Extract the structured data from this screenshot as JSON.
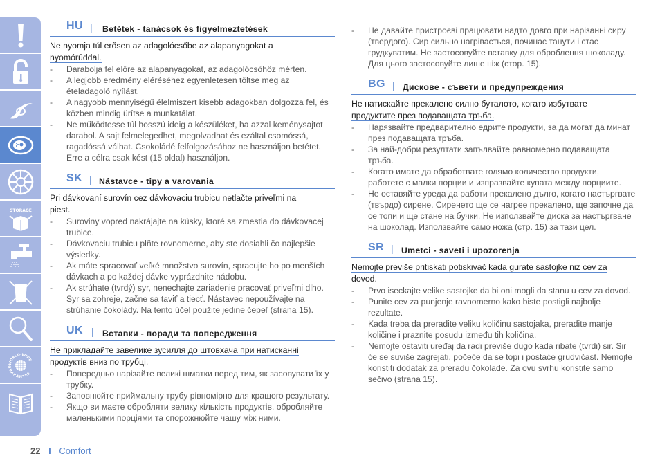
{
  "sidebar": {
    "tabs": [
      {
        "icon": "exclamation-icon",
        "active": false
      },
      {
        "icon": "unlocked-padlock-icon",
        "active": false
      },
      {
        "icon": "blade-icon",
        "active": false
      },
      {
        "icon": "disc-insert-icon",
        "active": true
      },
      {
        "icon": "fan-disc-icon",
        "active": false
      },
      {
        "icon": "storage-box-icon",
        "active": false
      },
      {
        "icon": "water-tap-icon",
        "active": false
      },
      {
        "icon": "crossed-bin-icon",
        "active": false
      },
      {
        "icon": "magnifier-icon",
        "active": false
      },
      {
        "icon": "world-wide-guarantee-icon",
        "active": false
      },
      {
        "icon": "open-book-icon",
        "active": false
      }
    ],
    "storage_text": "STORAGE",
    "guarantee_top": "WORLD-WIDE",
    "guarantee_bottom": "GUARANTEE"
  },
  "sections": {
    "hu": {
      "code": "HU",
      "separator": "|",
      "title": "Betétek - tanácsok és figyelmeztetések",
      "warning": [
        "Ne nyomja túl erősen az adagolócsőbe az alapanyagokat a",
        "nyomórúddal."
      ],
      "bullets": [
        "Darabolja fel előre az alapanyagokat, az adagolócsőhöz mérten.",
        "A legjobb eredmény eléréséhez egyenletesen töltse meg az ételadagoló nyílást.",
        "A nagyobb mennyiségű élelmiszert kisebb adagokban dolgozza fel, és közben mindig ürítse a munkatálat.",
        "Ne működtesse túl hosszú ideig a készüléket, ha azzal keménysajtot darabol. A sajt felmelegedhet, megolvadhat és ezáltal csomóssá, ragadóssá válhat. Csokoládé felfolgozásához ne használjon betétet. Erre a célra csak kést (15 oldal) használjon."
      ]
    },
    "sk": {
      "code": "SK",
      "separator": "|",
      "title": "Nástavce - tipy a varovania",
      "warning": [
        "Pri dávkovaní surovín cez dávkovaciu trubicu netlačte priveľmi na",
        "piest."
      ],
      "bullets": [
        "Suroviny vopred nakrájajte na kúsky, ktoré sa zmestia do dávkovacej trubice.",
        "Dávkovaciu trubicu plňte rovnomerne, aby ste dosiahli čo najlepšie výsledky.",
        "Ak máte spracovať veľké množstvo surovín, spracujte ho po menších dávkach a po každej dávke vyprázdnite nádobu.",
        "Ak strúhate (tvrdý) syr, nenechajte zariadenie pracovať priveľmi dlho. Syr sa zohreje, začne sa taviť a tiecť. Nástavec nepoužívajte na strúhanie čokolády. Na tento účel použite jedine čepeľ (strana 15)."
      ]
    },
    "uk": {
      "code": "UK",
      "separator": "|",
      "title": "Вставки - поради та попередження",
      "warning": [
        "Не прикладайте завелике зусилля до штовхача при натисканні",
        "продуктів вниз по трубці."
      ],
      "bullets": [
        "Попередньо нарізайте великі шматки перед тим, як засовувати їх у трубку.",
        "Заповнюйте приймальну трубу рівномірно для кращого результату.",
        "Якщо ви маєте обробляти велику кількість продуктів, обробляйте маленькими порціями та спорожнюйте чашу між ними.",
        "Не давайте пристроєві працювати надто довго при нарізанні сиру (твердого). Сир сильно нагрівається, починає танути і стає грудкуватим. Не застосовуйте вставку для оброблення шоколаду. Для цього застосовуйте лише ніж (стор. 15)."
      ]
    },
    "bg": {
      "code": "BG",
      "separator": "|",
      "title": "Дискове - съвети и предупреждения",
      "warning": [
        "Не натискайте прекалено силно буталото, когато избутвате",
        "продуктите през подаващата тръба."
      ],
      "bullets": [
        "Нарязвайте предварително едрите продукти, за да могат да минат през подаващата тръба.",
        "За най-добри резултати запълвайте равномерно подаващата тръба.",
        "Когато имате да обработвате голямо количество продукти, работете с малки порции и изпразвайте купата между порциите.",
        "Не оставяйте уреда да работи прекалено дълго, когато настъргвате (твърдо) сирене. Сиренето ще се нагрее прекалено, ще започне да се топи и ще стане на бучки. Не използвайте диска за настъргване на шоколад. Използвайте само ножа (стр. 15) за тази цел."
      ]
    },
    "sr": {
      "code": "SR",
      "separator": "|",
      "title": "Umetci - saveti i upozorenja",
      "warning": [
        "Nemojte previše pritiskati potiskivač kada gurate sastojke niz cev za",
        "dovod."
      ],
      "bullets": [
        "Prvo iseckajte velike sastojke da bi oni mogli da stanu u cev za dovod.",
        "Punite cev za punjenje ravnomerno kako biste postigli najbolje rezultate.",
        "Kada treba da preradite veliku količinu sastojaka, preradite manje količine i praznite posudu između tih količina.",
        "Nemojte ostaviti uređaj da radi previše dugo kada ribate (tvrdi) sir. Sir će se suviše zagrejati, počeće da se topi i postaće grudvičast. Nemojte koristiti dodatak za preradu čokolade. Za ovu svrhu koristite samo sečivo (strana 15)."
      ]
    }
  },
  "footer": {
    "page_number": "22",
    "separator": "I",
    "label": "Comfort"
  },
  "colors": {
    "accent": "#5b88cf",
    "sidebar": "#a6b6e2",
    "sidebar_active": "#5b88cf"
  }
}
